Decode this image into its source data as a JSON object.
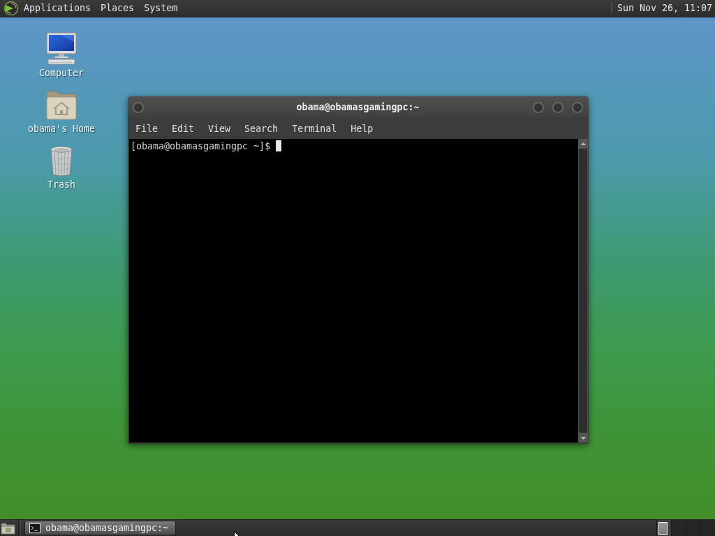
{
  "top_panel": {
    "menus": [
      {
        "label": "Applications"
      },
      {
        "label": "Places"
      },
      {
        "label": "System"
      }
    ],
    "clock": "Sun Nov 26, 11:07"
  },
  "desktop_icons": [
    {
      "kind": "computer",
      "label": "Computer"
    },
    {
      "kind": "home",
      "label": "obama's Home"
    },
    {
      "kind": "trash",
      "label": "Trash"
    }
  ],
  "terminal_window": {
    "title": "obama@obamasgamingpc:~",
    "menus": [
      "File",
      "Edit",
      "View",
      "Search",
      "Terminal",
      "Help"
    ],
    "prompt": "[obama@obamasgamingpc ~]$"
  },
  "bottom_panel": {
    "tasks": [
      {
        "label": "obama@obamasgamingpc:~",
        "selected": true
      }
    ],
    "workspaces": [
      {
        "selected": true,
        "has_window": true
      },
      {
        "selected": false,
        "has_window": false
      },
      {
        "selected": false,
        "has_window": false
      },
      {
        "selected": false,
        "has_window": false
      }
    ]
  }
}
